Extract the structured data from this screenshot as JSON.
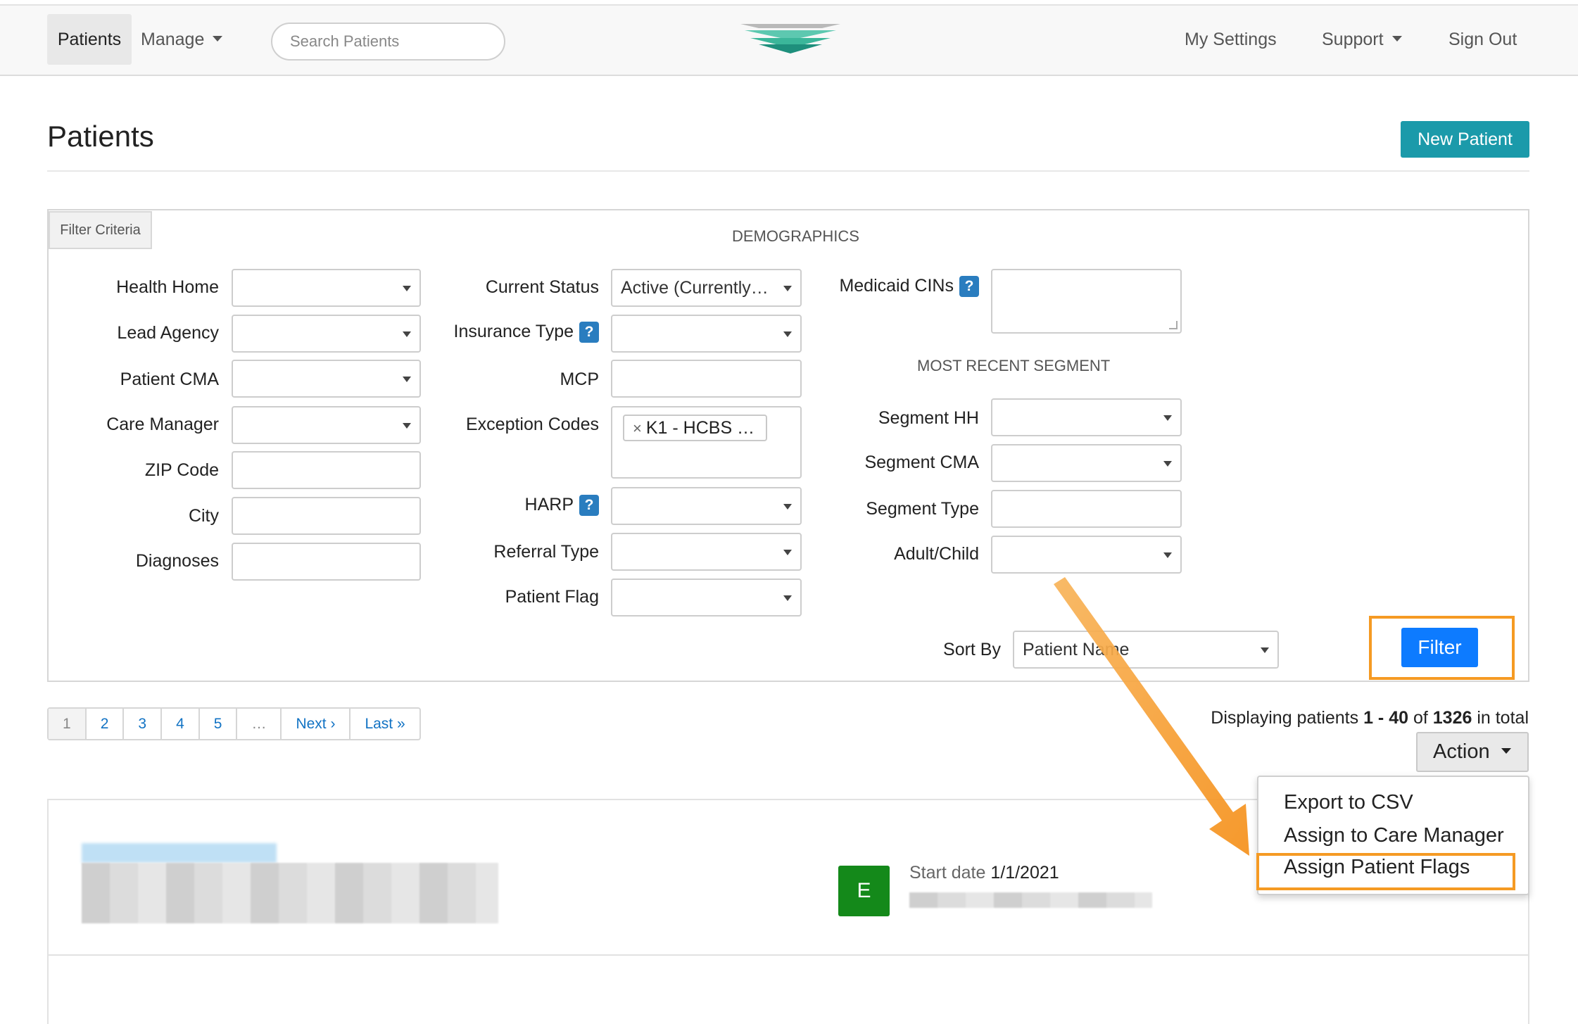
{
  "nav": {
    "patients": "Patients",
    "manage": "Manage",
    "search_placeholder": "Search Patients",
    "my_settings": "My Settings",
    "support": "Support",
    "sign_out": "Sign Out",
    "logo_icon": "layered-chevron-logo"
  },
  "page": {
    "title": "Patients",
    "new_patient": "New Patient"
  },
  "filter": {
    "tab": "Filter Criteria",
    "demographics": "DEMOGRAPHICS",
    "health_home": "Health Home",
    "lead_agency": "Lead Agency",
    "patient_cma": "Patient CMA",
    "care_manager": "Care Manager",
    "zip_code": "ZIP Code",
    "city": "City",
    "diagnoses": "Diagnoses",
    "current_status": "Current Status",
    "current_status_value": "Active (Currently…",
    "insurance_type": "Insurance Type",
    "mcp": "MCP",
    "exception_codes": "Exception Codes",
    "exception_tag": "K1 - HCBS …",
    "harp": "HARP",
    "referral_type": "Referral Type",
    "patient_flag": "Patient Flag",
    "medicaid_cins": "Medicaid CINs",
    "most_recent_segment": "MOST RECENT SEGMENT",
    "segment_hh": "Segment HH",
    "segment_cma": "Segment CMA",
    "segment_type": "Segment Type",
    "adult_child": "Adult/Child",
    "sort_by": "Sort By",
    "sort_by_value": "Patient Name",
    "filter_button": "Filter",
    "help": "?",
    "tag_remove": "×"
  },
  "pagination": [
    "1",
    "2",
    "3",
    "4",
    "5",
    "…",
    "Next ›",
    "Last »"
  ],
  "results": {
    "prefix": "Displaying patients ",
    "range": "1 - 40",
    "of": " of ",
    "total": "1326",
    "suffix": " in total"
  },
  "action": {
    "label": "Action",
    "items": [
      "Export to CSV",
      "Assign to Care Manager",
      "Assign Patient Flags"
    ]
  },
  "patient_card": {
    "badge": "E",
    "start_label": "Start date",
    "start_value": "1/1/2021"
  },
  "colors": {
    "new_patient_bg": "#1b9aaa",
    "filter_btn_bg": "#0d7bff",
    "highlight": "#f59a23",
    "badge_green": "#14891a",
    "help_icon_bg": "#2a7dbf"
  }
}
